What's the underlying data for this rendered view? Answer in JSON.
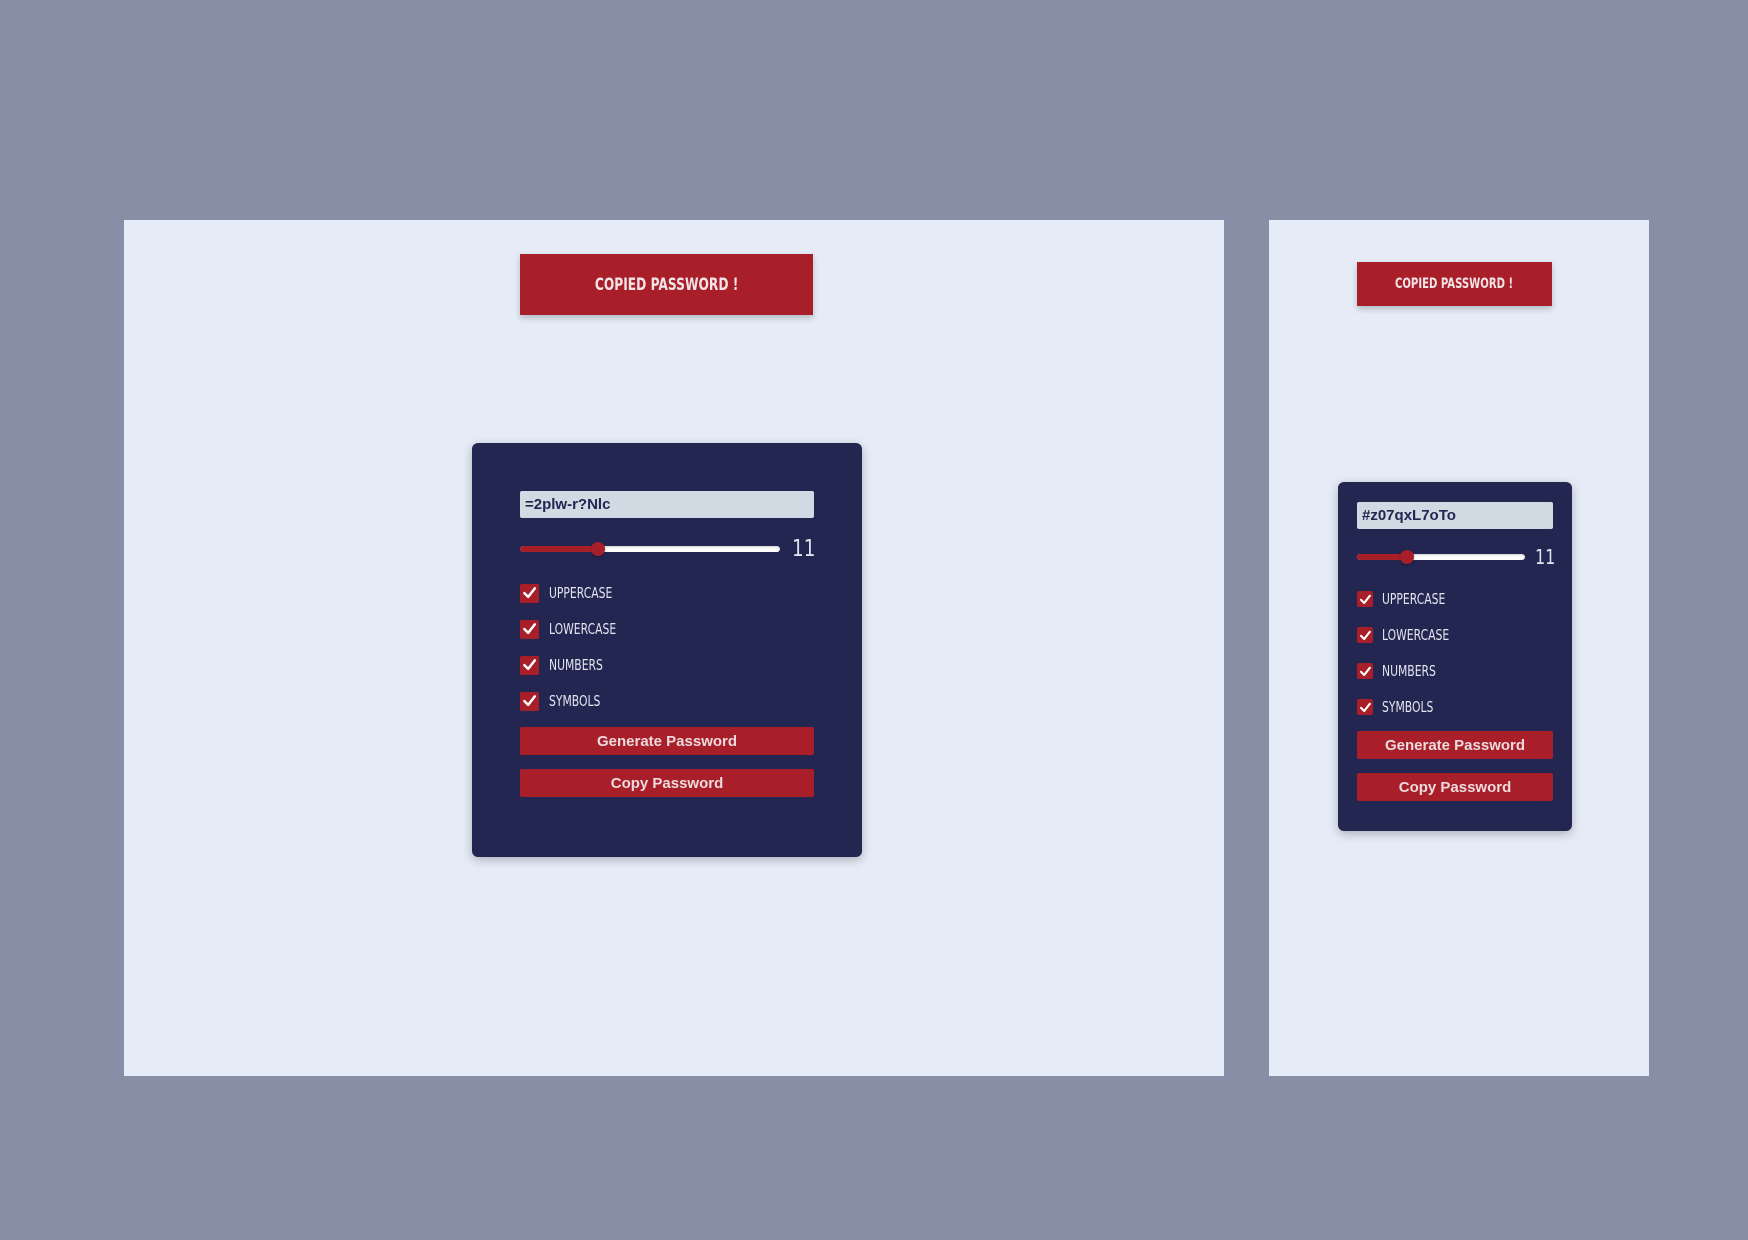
{
  "toast": {
    "text": "Copied Password !"
  },
  "desktop": {
    "password_value": "=2plw-r?Nlc",
    "length": "11",
    "length_fraction": 0.3,
    "options": [
      {
        "label": "Uppercase",
        "checked": true
      },
      {
        "label": "Lowercase",
        "checked": true
      },
      {
        "label": "Numbers",
        "checked": true
      },
      {
        "label": "Symbols",
        "checked": true
      }
    ],
    "generate_label": "Generate Password",
    "copy_label": "Copy Password"
  },
  "mobile": {
    "password_value": "#z07qxL7oTo",
    "length": "11",
    "length_fraction": 0.3,
    "options": [
      {
        "label": "Uppercase",
        "checked": true
      },
      {
        "label": "Lowercase",
        "checked": true
      },
      {
        "label": "Numbers",
        "checked": true
      },
      {
        "label": "Symbols",
        "checked": true
      }
    ],
    "generate_label": "Generate Password",
    "copy_label": "Copy Password"
  },
  "colors": {
    "backdrop": "#898ea7",
    "page_bg": "#e5ecf7",
    "card_bg": "#222650",
    "accent": "#a81f2a",
    "input_bg": "#d1d9e2"
  },
  "icons": {
    "checkbox": "check-icon"
  }
}
